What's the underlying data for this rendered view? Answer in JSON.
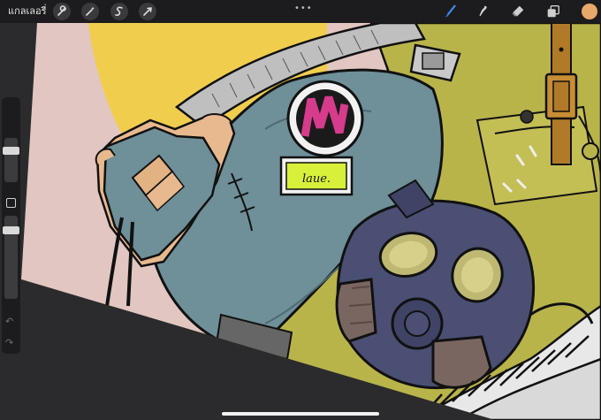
{
  "toolbar": {
    "gallery_label": "แกลเลอรี่",
    "left_tools": [
      "wrench-icon",
      "magic-wand-icon",
      "selection-icon",
      "transform-icon"
    ],
    "menu_dots": "•••",
    "right_tools": [
      "brush-icon",
      "smudge-icon",
      "eraser-icon",
      "layers-icon"
    ],
    "active_tool": "brush-icon",
    "active_color": "#e8a86a",
    "accent": "#3d8df5"
  },
  "sidebar": {
    "brush_size": 0.45,
    "opacity": 0.62,
    "undo_glyph": "↶",
    "redo_glyph": "↷"
  },
  "artwork": {
    "patch_text": "laue.",
    "colors": {
      "background_pink": "#e2c6c1",
      "sun_yellow": "#f1cd4e",
      "jacket_olive": "#b9b44a",
      "sleeve_blue": "#6f8f99",
      "mask_navy": "#4a4f73",
      "strap_brown": "#b07a28",
      "patch_magenta": "#d63b8c",
      "patch_lime": "#d8f03a"
    }
  }
}
